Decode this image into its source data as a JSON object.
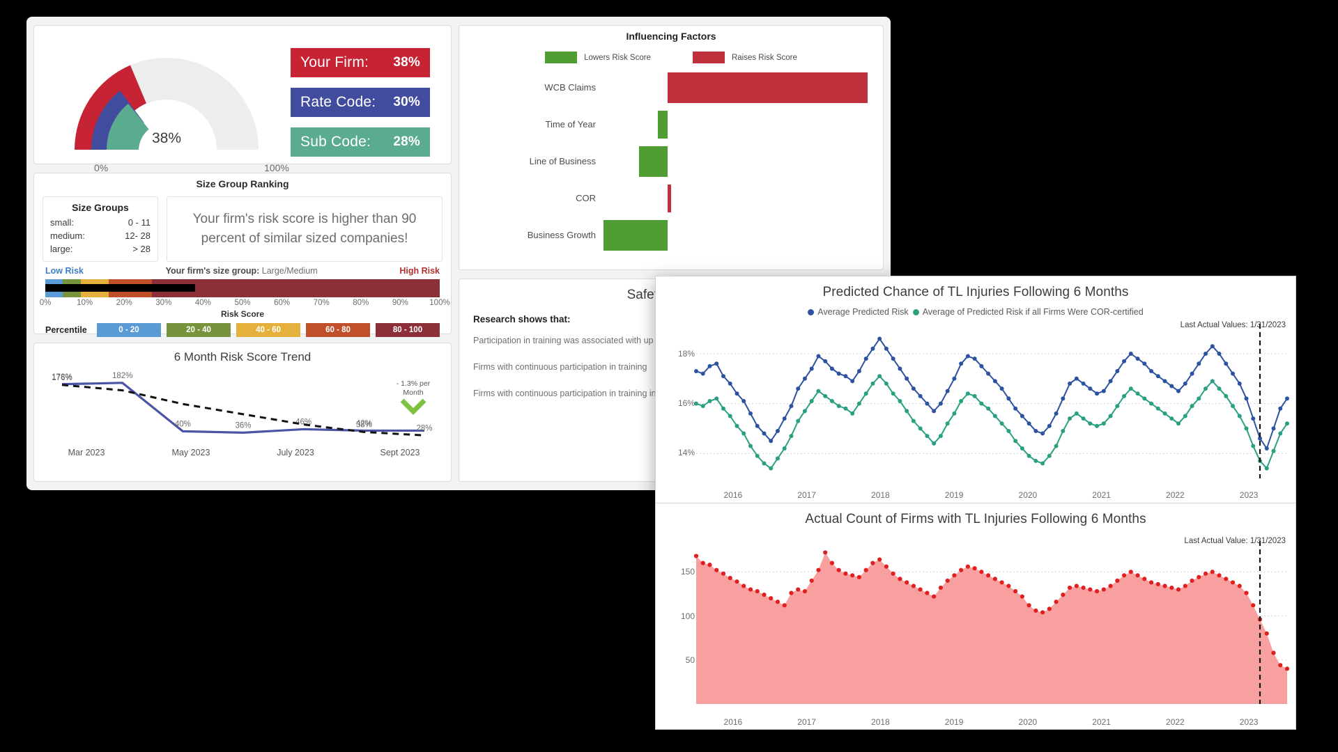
{
  "gauge": {
    "value_label": "38%",
    "min_label": "0%",
    "max_label": "100%",
    "segments": [
      {
        "name": "your-firm",
        "color": "#c62434",
        "value": 38
      },
      {
        "name": "rate-code",
        "color": "#414c9e",
        "value": 30
      },
      {
        "name": "sub-code",
        "color": "#5bab8e",
        "value": 28
      }
    ],
    "track_color": "#ededed"
  },
  "badges": [
    {
      "name": "your-firm",
      "label": "Your Firm:",
      "value": "38%",
      "color": "#c62434"
    },
    {
      "name": "rate-code",
      "label": "Rate Code:",
      "value": "30%",
      "color": "#414c9e"
    },
    {
      "name": "sub-code",
      "label": "Sub Code:",
      "value": "28%",
      "color": "#5bab8e"
    }
  ],
  "size_group": {
    "title": "Size Group Ranking",
    "groups_title": "Size Groups",
    "groups": [
      {
        "label": "small:",
        "range": "0 - 11"
      },
      {
        "label": "medium:",
        "range": "12- 28"
      },
      {
        "label": "large:",
        "range": "> 28"
      }
    ],
    "message": "Your firm's risk score is higher than 90 percent of similar sized companies!",
    "low_risk_label": "Low Risk",
    "high_risk_label": "High Risk",
    "your_group_prefix": "Your firm's size group:",
    "your_group_value": "Large/Medium",
    "axis_title": "Risk Score",
    "ticks": [
      "0%",
      "10%",
      "20%",
      "30%",
      "40%",
      "50%",
      "60%",
      "70%",
      "80%",
      "90%",
      "100%"
    ],
    "marker_percent": 38,
    "percentile_label": "Percentile",
    "percentile_chips": [
      {
        "label": "0 - 20",
        "color": "#5b9bd5"
      },
      {
        "label": "20 - 40",
        "color": "#77933c"
      },
      {
        "label": "40 - 60",
        "color": "#e5b03b"
      },
      {
        "label": "60 - 80",
        "color": "#c0502a"
      },
      {
        "label": "80 - 100",
        "color": "#8c2f39"
      }
    ]
  },
  "chart_data": [
    {
      "type": "line",
      "name": "six-month-risk-score-trend",
      "title": "6 Month Risk Score Trend",
      "categories": [
        "Mar 2023",
        "May 2023",
        "July 2023",
        "Sept 2023"
      ],
      "x": [
        0,
        1,
        2,
        3,
        4,
        5,
        6
      ],
      "series": [
        {
          "name": "Risk Score",
          "color": "#4a53a5",
          "values": [
            178,
            182,
            40,
            36,
            46,
            42,
            42
          ],
          "labels": [
            "178%",
            "182%",
            "40%",
            "36%",
            "46%",
            "42%",
            ""
          ]
        },
        {
          "name": "Trend",
          "color": "#111111",
          "style": "dashed",
          "values": [
            176,
            160,
            120,
            90,
            60,
            38,
            28
          ],
          "labels": [
            "176%",
            "",
            "",
            "",
            "",
            "38%",
            "28%"
          ]
        }
      ],
      "annotation": "- 1.3% per Month",
      "annotation_icon": "chevron-down-icon",
      "annotation_color": "#7ec242",
      "grid": false,
      "ylabel": "",
      "xlabel": ""
    },
    {
      "type": "bar",
      "name": "influencing-factors",
      "title": "Influencing Factors",
      "orientation": "horizontal",
      "legend": [
        {
          "label": "Lowers Risk Score",
          "color": "#4f9d33"
        },
        {
          "label": "Raises Risk Score",
          "color": "#c0303c"
        }
      ],
      "categories": [
        "WCB Claims",
        "Time of Year",
        "Line of Business",
        "COR",
        "Business Growth"
      ],
      "values": [
        62,
        -3,
        -9,
        1,
        -20
      ],
      "baseline": 0,
      "grid": false
    },
    {
      "type": "line",
      "name": "predicted-chance-tl-injuries",
      "title": "Predicted Chance of TL Injuries Following 6 Months",
      "legend_position": "top",
      "legend": [
        {
          "label": "Average Predicted Risk",
          "color": "#2d52a0"
        },
        {
          "label": "Average of Predicted Risk if all Firms Were COR-certified",
          "color": "#2aa083"
        }
      ],
      "xticks": [
        "2016",
        "2017",
        "2018",
        "2019",
        "2020",
        "2021",
        "2022",
        "2023"
      ],
      "yticks": [
        "14%",
        "16%",
        "18%"
      ],
      "ylim": [
        13.0,
        19.2
      ],
      "annotation": "Last Actual Values: 1/31/2023",
      "series": [
        {
          "name": "Average Predicted Risk",
          "color": "#2d52a0",
          "values": [
            17.3,
            17.2,
            17.5,
            17.6,
            17.1,
            16.8,
            16.4,
            16.1,
            15.6,
            15.1,
            14.8,
            14.5,
            14.9,
            15.4,
            15.9,
            16.6,
            17.0,
            17.4,
            17.9,
            17.7,
            17.4,
            17.2,
            17.1,
            16.9,
            17.3,
            17.8,
            18.2,
            18.6,
            18.2,
            17.8,
            17.4,
            17.0,
            16.6,
            16.3,
            16.0,
            15.7,
            16.0,
            16.5,
            17.0,
            17.6,
            17.9,
            17.8,
            17.5,
            17.2,
            16.9,
            16.6,
            16.2,
            15.8,
            15.5,
            15.2,
            14.9,
            14.8,
            15.1,
            15.6,
            16.2,
            16.8,
            17.0,
            16.8,
            16.6,
            16.4,
            16.5,
            16.9,
            17.3,
            17.7,
            18.0,
            17.8,
            17.6,
            17.3,
            17.1,
            16.9,
            16.7,
            16.5,
            16.8,
            17.2,
            17.6,
            18.0,
            18.3,
            18.0,
            17.6,
            17.2,
            16.8,
            16.2,
            15.4,
            14.6,
            14.2,
            15.0,
            15.8,
            16.2
          ]
        },
        {
          "name": "Average of Predicted Risk if all Firms Were COR-certified",
          "color": "#2aa083",
          "values": [
            16.0,
            15.9,
            16.1,
            16.2,
            15.8,
            15.5,
            15.1,
            14.8,
            14.3,
            13.9,
            13.6,
            13.4,
            13.8,
            14.2,
            14.7,
            15.3,
            15.7,
            16.1,
            16.5,
            16.3,
            16.1,
            15.9,
            15.8,
            15.6,
            16.0,
            16.4,
            16.8,
            17.1,
            16.8,
            16.4,
            16.1,
            15.7,
            15.3,
            15.0,
            14.7,
            14.4,
            14.7,
            15.2,
            15.6,
            16.1,
            16.4,
            16.3,
            16.0,
            15.8,
            15.5,
            15.2,
            14.9,
            14.5,
            14.2,
            13.9,
            13.7,
            13.6,
            13.9,
            14.3,
            14.9,
            15.4,
            15.6,
            15.4,
            15.2,
            15.1,
            15.2,
            15.5,
            15.9,
            16.3,
            16.6,
            16.4,
            16.2,
            16.0,
            15.8,
            15.6,
            15.4,
            15.2,
            15.5,
            15.9,
            16.2,
            16.6,
            16.9,
            16.6,
            16.3,
            15.9,
            15.5,
            15.0,
            14.3,
            13.7,
            13.4,
            14.1,
            14.8,
            15.2
          ]
        }
      ],
      "grid": true
    },
    {
      "type": "area",
      "name": "actual-count-firms-tl-injuries",
      "title": "Actual Count of Firms with TL Injuries Following 6 Months",
      "xticks": [
        "2016",
        "2017",
        "2018",
        "2019",
        "2020",
        "2021",
        "2022",
        "2023"
      ],
      "yticks": [
        "50",
        "100",
        "150"
      ],
      "ylim": [
        0,
        185
      ],
      "annotation": "Last Actual Value: 1/31/2023",
      "marker_color": "#e02020",
      "fill_color": "#f8a0a0",
      "series": [
        {
          "name": "Count",
          "values": [
            168,
            160,
            158,
            152,
            148,
            143,
            139,
            134,
            130,
            128,
            124,
            120,
            116,
            112,
            126,
            130,
            128,
            140,
            152,
            172,
            160,
            152,
            148,
            146,
            144,
            152,
            160,
            164,
            156,
            148,
            142,
            138,
            134,
            130,
            126,
            122,
            132,
            140,
            146,
            152,
            156,
            154,
            150,
            146,
            142,
            138,
            134,
            128,
            122,
            112,
            106,
            104,
            108,
            116,
            124,
            132,
            134,
            132,
            130,
            128,
            130,
            134,
            140,
            146,
            150,
            146,
            142,
            138,
            136,
            134,
            132,
            130,
            134,
            140,
            144,
            148,
            150,
            146,
            142,
            138,
            134,
            126,
            112,
            96,
            80,
            58,
            44,
            40
          ]
        }
      ],
      "grid": true
    }
  ],
  "safety": {
    "title": "Safety Training",
    "heading": "Research shows that:",
    "paragraphs": [
      "Participation in training was associated with up in the culture of reporting minor incidents.",
      "Firms with continuous participation in training",
      "Firms with continuous participation in training injury reduction."
    ]
  }
}
